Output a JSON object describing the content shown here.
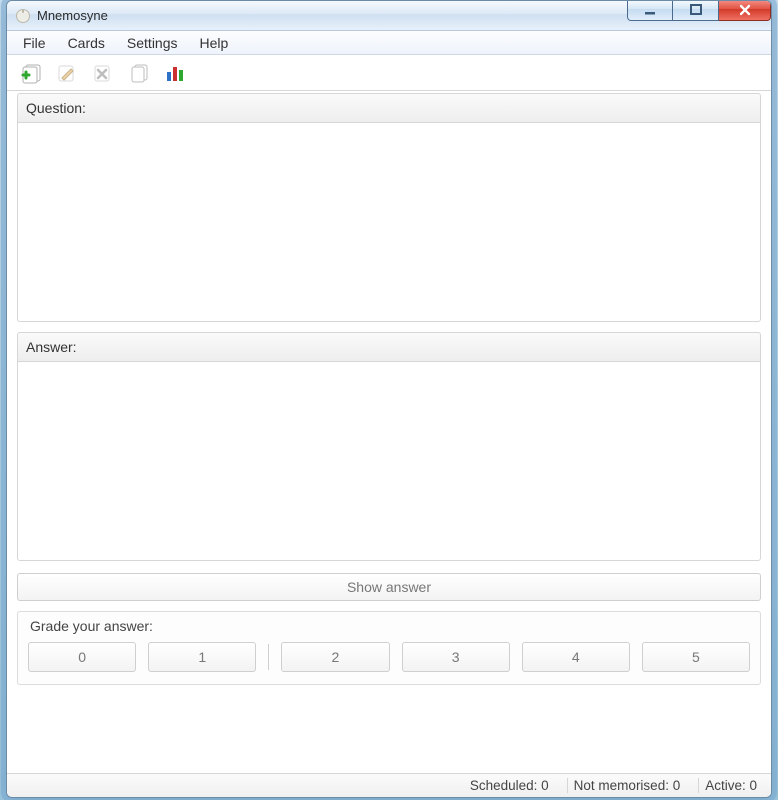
{
  "title": "Mnemosyne",
  "menubar": {
    "items": [
      "File",
      "Cards",
      "Settings",
      "Help"
    ]
  },
  "toolbar": {
    "buttons": [
      {
        "name": "add-card-button",
        "icon": "add-card-icon",
        "enabled": true
      },
      {
        "name": "edit-card-button",
        "icon": "edit-card-icon",
        "enabled": false
      },
      {
        "name": "delete-card-button",
        "icon": "delete-card-icon",
        "enabled": false
      },
      {
        "name": "browse-cards-button",
        "icon": "cards-stack-icon",
        "enabled": true
      },
      {
        "name": "statistics-button",
        "icon": "statistics-icon",
        "enabled": true
      }
    ]
  },
  "labels": {
    "question": "Question:",
    "answer": "Answer:",
    "show_answer": "Show answer",
    "grade_title": "Grade your answer:"
  },
  "grades": [
    "0",
    "1",
    "2",
    "3",
    "4",
    "5"
  ],
  "status": {
    "scheduled": "Scheduled: 0",
    "not_memorised": "Not memorised: 0",
    "active": "Active: 0"
  }
}
